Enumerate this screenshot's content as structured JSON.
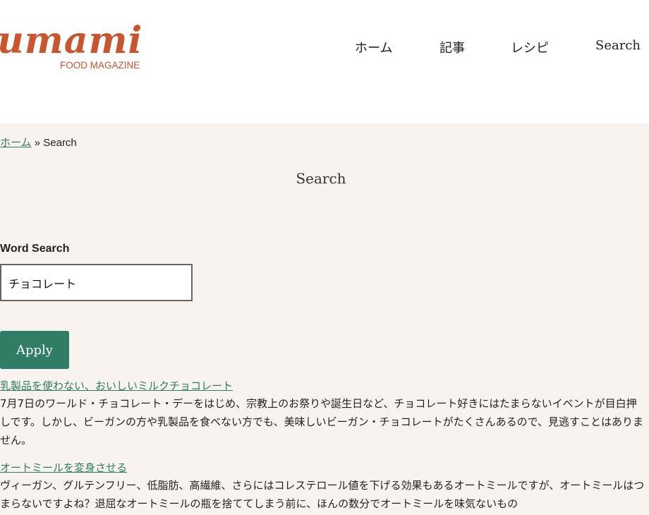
{
  "header": {
    "logo_word": "umami",
    "logo_subtitle": "FOOD MAGAZINE",
    "nav": {
      "home": "ホーム",
      "articles": "記事",
      "recipes": "レシピ",
      "search": "Search"
    }
  },
  "main": {
    "breadcrumb": {
      "home": "ホーム",
      "separator": " » ",
      "current": "Search"
    },
    "title": "Search",
    "search_form": {
      "label": "Word Search",
      "value": "チョコレート",
      "submit": "Apply"
    },
    "results": [
      {
        "title": "乳製品を使わない、おいしいミルクチョコレート",
        "excerpt": "7月7日のワールド・チョコレート・デーをはじめ、宗教上のお祭りや誕生日など、チョコレート好きにはたまらないイベントが目白押しです。しかし、ビーガンの方や乳製品を食べない方でも、美味しいビーガン・チョコレートがたくさんあるので、見逃すことはありません。"
      },
      {
        "title": "オートミールを変身させる",
        "excerpt": "ヴィーガン、グルテンフリー、低脂肪、高繊維、さらにはコレステロール値を下げる効果もあるオートミールですが、オートミールはつまらないですよね？退屈なオートミールの瓶を捨ててしまう前に、ほんの数分でオートミールを味気ないもの"
      }
    ]
  },
  "colors": {
    "brand": "#c8552e",
    "accent": "#2e7d64",
    "main_background": "#f8f3ee"
  }
}
